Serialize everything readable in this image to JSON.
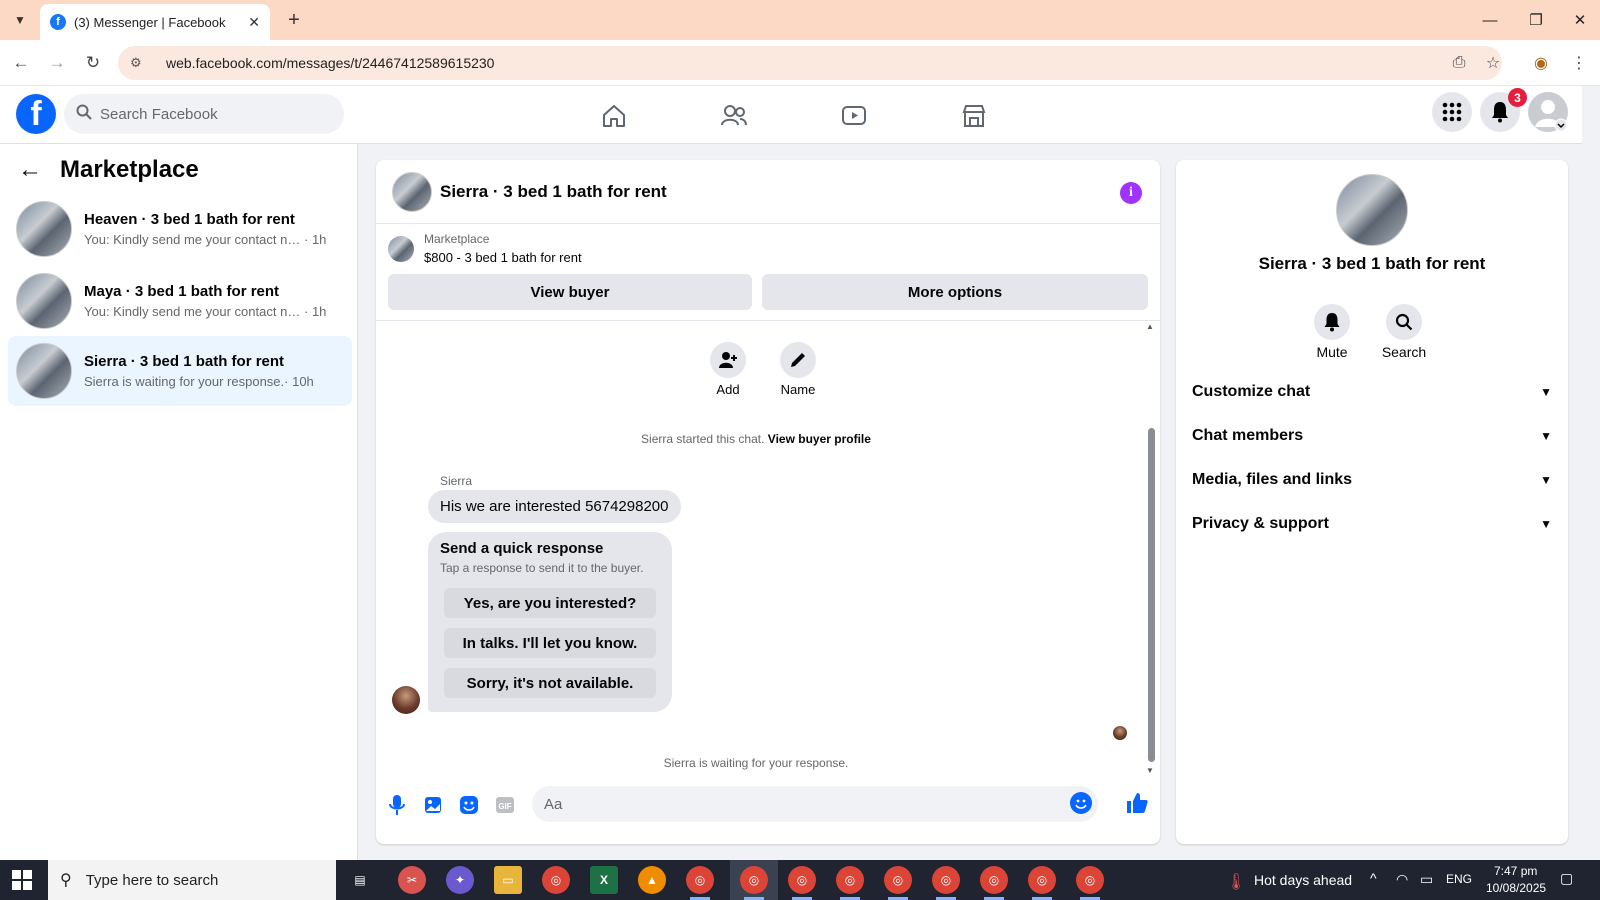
{
  "browser": {
    "tab_title": "(3) Messenger | Facebook",
    "url": "web.facebook.com/messages/t/24467412589615230"
  },
  "fb_nav": {
    "search_placeholder": "Search Facebook",
    "notification_count": "3"
  },
  "left_pane": {
    "title": "Marketplace",
    "conversations": [
      {
        "name": "Heaven · 3 bed 1 bath for rent",
        "preview": "You: Kindly send me your contact nu...",
        "time": "· 1h",
        "active": false
      },
      {
        "name": "Maya · 3 bed 1 bath for rent",
        "preview": "You: Kindly send me your contact nu...",
        "time": "· 1h",
        "active": false
      },
      {
        "name": "Sierra · 3 bed 1 bath for rent",
        "preview": "Sierra is waiting for your response.",
        "time": "· 10h",
        "active": true
      }
    ]
  },
  "chat": {
    "title": "Sierra · 3 bed 1 bath for rent",
    "marketplace_label": "Marketplace",
    "listing": "$800 - 3 bed 1 bath for rent",
    "view_buyer": "View buyer",
    "more_options": "More options",
    "add_label": "Add",
    "name_label": "Name",
    "started_text": "Sierra started this chat.",
    "view_buyer_profile": "View buyer profile",
    "sender": "Sierra",
    "message": "His we are interested 5674298200",
    "quick_title": "Send a quick response",
    "quick_sub": "Tap a response to send it to the buyer.",
    "quick_replies": [
      "Yes, are you interested?",
      "In talks. I'll let you know.",
      "Sorry, it's not available."
    ],
    "waiting_text": "Sierra is waiting for your response.",
    "composer_placeholder": "Aa"
  },
  "right_pane": {
    "name": "Sierra · 3 bed 1 bath for rent",
    "mute_label": "Mute",
    "search_label": "Search",
    "sections": [
      "Customize chat",
      "Chat members",
      "Media, files and links",
      "Privacy & support"
    ]
  },
  "taskbar": {
    "search_placeholder": "Type here to search",
    "weather": "Hot days ahead",
    "language": "ENG",
    "time": "7:47 pm",
    "date": "10/08/2025"
  },
  "colors": {
    "fb_blue": "#0866ff",
    "info_purple": "#a033ff",
    "active_conv": "#ebf5ff",
    "badge_red": "#e41e3f"
  }
}
